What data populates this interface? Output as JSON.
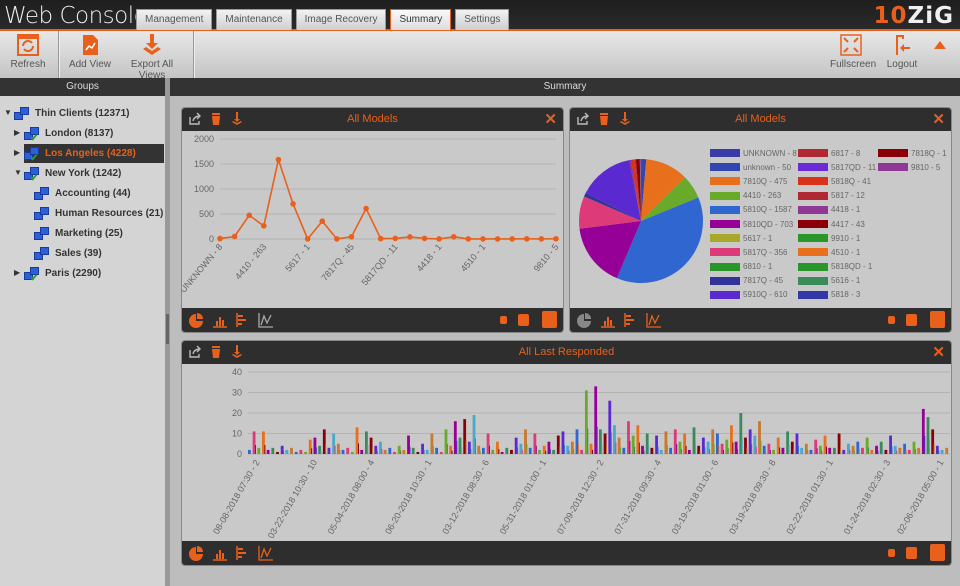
{
  "app": {
    "title": "Web Console",
    "logo": "10ZiG"
  },
  "tabs": [
    {
      "label": "Management"
    },
    {
      "label": "Maintenance"
    },
    {
      "label": "Image Recovery"
    },
    {
      "label": "Summary",
      "active": true
    },
    {
      "label": "Settings"
    }
  ],
  "toolbar": {
    "refresh": "Refresh",
    "add_view": "Add View",
    "export_all": "Export All Views",
    "fullscreen": "Fullscreen",
    "logout": "Logout"
  },
  "groups": {
    "title": "Groups",
    "items": [
      {
        "label": "Thin Clients (12371)",
        "expanded": true
      },
      {
        "label": "London (8137)",
        "expanded": false
      },
      {
        "label": "Los Angeles (4228)",
        "expanded": false,
        "selected": true
      },
      {
        "label": "New York (1242)",
        "expanded": true
      },
      {
        "label": "Accounting (44)"
      },
      {
        "label": "Human Resources (21)"
      },
      {
        "label": "Marketing (25)"
      },
      {
        "label": "Sales (39)"
      },
      {
        "label": "Paris (2290)",
        "expanded": false
      }
    ]
  },
  "summary": {
    "title": "Summary"
  },
  "colors": {
    "accent": "#e8601c",
    "header": "#2e2e2e"
  },
  "panels": [
    {
      "title": "All Models"
    },
    {
      "title": "All Models"
    },
    {
      "title": "All Last Responded"
    }
  ],
  "chart_data": [
    {
      "type": "line",
      "title": "All Models",
      "color": "#e8601c",
      "ylim": [
        0,
        2000
      ],
      "yticks": [
        0,
        500,
        1000,
        1500,
        2000
      ],
      "grid": true,
      "categories": [
        "UNKNOWN - 8",
        "unknown - 50",
        "7810Q - 475",
        "4410 - 263",
        "5810Q - 1587",
        "5810QD - 703",
        "5617 - 1",
        "5817Q - 356",
        "6810 - 1",
        "7817Q - 45",
        "5910Q - 610",
        "6817 - 8",
        "5817QD - 11",
        "5818Q - 41",
        "5817 - 12",
        "4418 - 1",
        "4417 - 43",
        "9910 - 1",
        "4510 - 1",
        "5818QD - 1",
        "5616 - 1",
        "5818 - 3",
        "7818Q - 1",
        "9810 - 5"
      ],
      "values": [
        8,
        50,
        475,
        263,
        1587,
        703,
        1,
        356,
        1,
        45,
        610,
        8,
        11,
        41,
        12,
        1,
        43,
        1,
        1,
        1,
        1,
        3,
        1,
        5
      ]
    },
    {
      "type": "pie",
      "title": "All Models",
      "legend": "right",
      "categories": [
        "UNKNOWN - 8",
        "unknown - 50",
        "7810Q - 475",
        "4410 - 263",
        "5810Q - 1587",
        "5810QD - 703",
        "5617 - 1",
        "5817Q - 356",
        "6810 - 1",
        "7817Q - 45",
        "5910Q - 610",
        "6817 - 8",
        "5817QD - 11",
        "5818Q - 41",
        "5817 - 12",
        "4418 - 1",
        "4417 - 43",
        "9910 - 1",
        "4510 - 1",
        "5818QD - 1",
        "5616 - 1",
        "5818 - 3",
        "7818Q - 1",
        "9810 - 5"
      ],
      "values": [
        8,
        50,
        475,
        263,
        1587,
        703,
        1,
        356,
        1,
        45,
        610,
        8,
        11,
        41,
        12,
        1,
        43,
        1,
        1,
        1,
        1,
        3,
        1,
        5
      ],
      "colors": [
        "#3a3aa8",
        "#3346b0",
        "#e8701c",
        "#6aaa2a",
        "#2f66d0",
        "#960096",
        "#a8a82a",
        "#dc3a78",
        "#2a962a",
        "#33339a",
        "#5a2ad0",
        "#b02832",
        "#6a2ad6",
        "#d8321a",
        "#b02832",
        "#903896",
        "#8a0008",
        "#2a962a",
        "#e8701c",
        "#2a962a",
        "#3a8a5a",
        "#3338a8",
        "#8a0008",
        "#903896"
      ]
    },
    {
      "type": "bar",
      "title": "All Last Responded",
      "ylim": [
        0,
        40
      ],
      "yticks": [
        0,
        10,
        20,
        30,
        40
      ],
      "grid": true,
      "xticklabels": [
        "08-08-2018 07:30 - 2",
        "03-22-2018 10:30 - 10",
        "05-04-2018 08:00 - 4",
        "06-20-2018 10:30 - 1",
        "03-12-2018 08:30 - 6",
        "05-31-2018 01:00 - 1",
        "07-09-2018 12:30 - 2",
        "07-31-2018 09:30 - 4",
        "03-19-2018 01:00 - 6",
        "03-19-2018 09:30 - 8",
        "02-22-2018 01:30 - 1",
        "01-24-2018 02:30 - 3",
        "02-06-2018 05:00 - 1"
      ],
      "values": [
        2,
        11,
        3,
        11,
        2,
        3,
        1,
        4,
        2,
        3,
        1,
        2,
        1,
        7,
        8,
        4,
        12,
        3,
        10,
        5,
        2,
        3,
        1,
        13,
        2,
        11,
        8,
        4,
        6,
        2,
        3,
        1,
        4,
        2,
        9,
        3,
        1,
        5,
        2,
        10,
        3,
        1,
        12,
        4,
        16,
        8,
        17,
        6,
        19,
        4,
        3,
        10,
        2,
        6,
        1,
        3,
        2,
        8,
        5,
        12,
        3,
        10,
        2,
        4,
        6,
        2,
        9,
        11,
        4,
        6,
        12,
        2,
        31,
        5,
        33,
        12,
        10,
        26,
        14,
        8,
        3,
        16,
        9,
        14,
        4,
        10,
        3,
        9,
        2,
        11,
        3,
        12,
        6,
        10,
        2,
        13,
        4,
        8,
        6,
        12,
        10,
        5,
        7,
        14,
        6,
        20,
        8,
        12,
        9,
        16,
        4,
        5,
        2,
        8,
        3,
        11,
        6,
        10,
        3,
        5,
        2,
        7,
        4,
        9,
        3,
        3,
        10,
        2,
        5,
        4,
        6,
        3,
        8,
        2,
        4,
        6,
        2,
        9,
        4,
        3,
        5,
        2,
        6,
        3,
        22,
        18,
        12,
        4,
        2,
        3
      ]
    }
  ]
}
